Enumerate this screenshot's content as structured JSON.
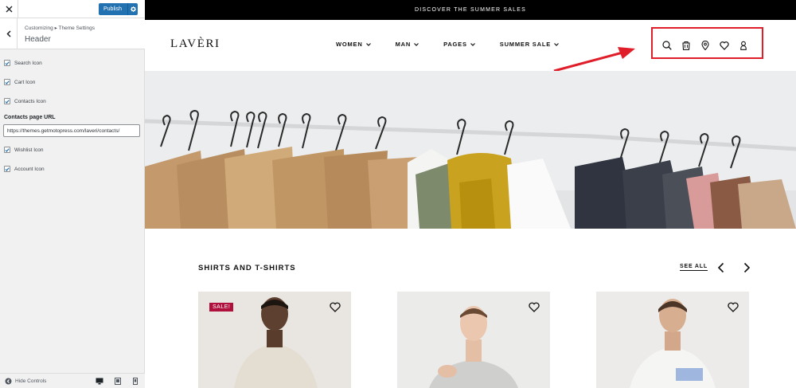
{
  "customizer": {
    "publish_label": "Publish",
    "breadcrumb": "Customizing ▸ Theme Settings",
    "section_title": "Header",
    "options": [
      {
        "label": "Search Icon",
        "checked": true
      },
      {
        "label": "Cart Icon",
        "checked": true
      },
      {
        "label": "Contacts Icon",
        "checked": true
      },
      {
        "label": "Wishlist Icon",
        "checked": true
      },
      {
        "label": "Account Icon",
        "checked": true
      }
    ],
    "contacts_url_label": "Contacts page URL",
    "contacts_url_value": "https://themes.getmotopress.com/laveri/contacts/",
    "hide_controls": "Hide Controls"
  },
  "site": {
    "announcement": "DISCOVER THE SUMMER SALES",
    "logo": "LAVÈRI",
    "nav": [
      {
        "label": "WOMEN"
      },
      {
        "label": "MAN"
      },
      {
        "label": "PAGES"
      },
      {
        "label": "SUMMER SALE"
      }
    ],
    "header_icons": [
      "search-icon",
      "cart-icon",
      "location-icon",
      "heart-icon",
      "user-icon"
    ],
    "highlight_color": "#e01e2a",
    "section": {
      "title": "SHIRTS AND T-SHIRTS",
      "see_all": "SEE ALL"
    },
    "products": [
      {
        "badge": "SALE!"
      },
      {
        "badge": ""
      },
      {
        "badge": ""
      }
    ]
  }
}
